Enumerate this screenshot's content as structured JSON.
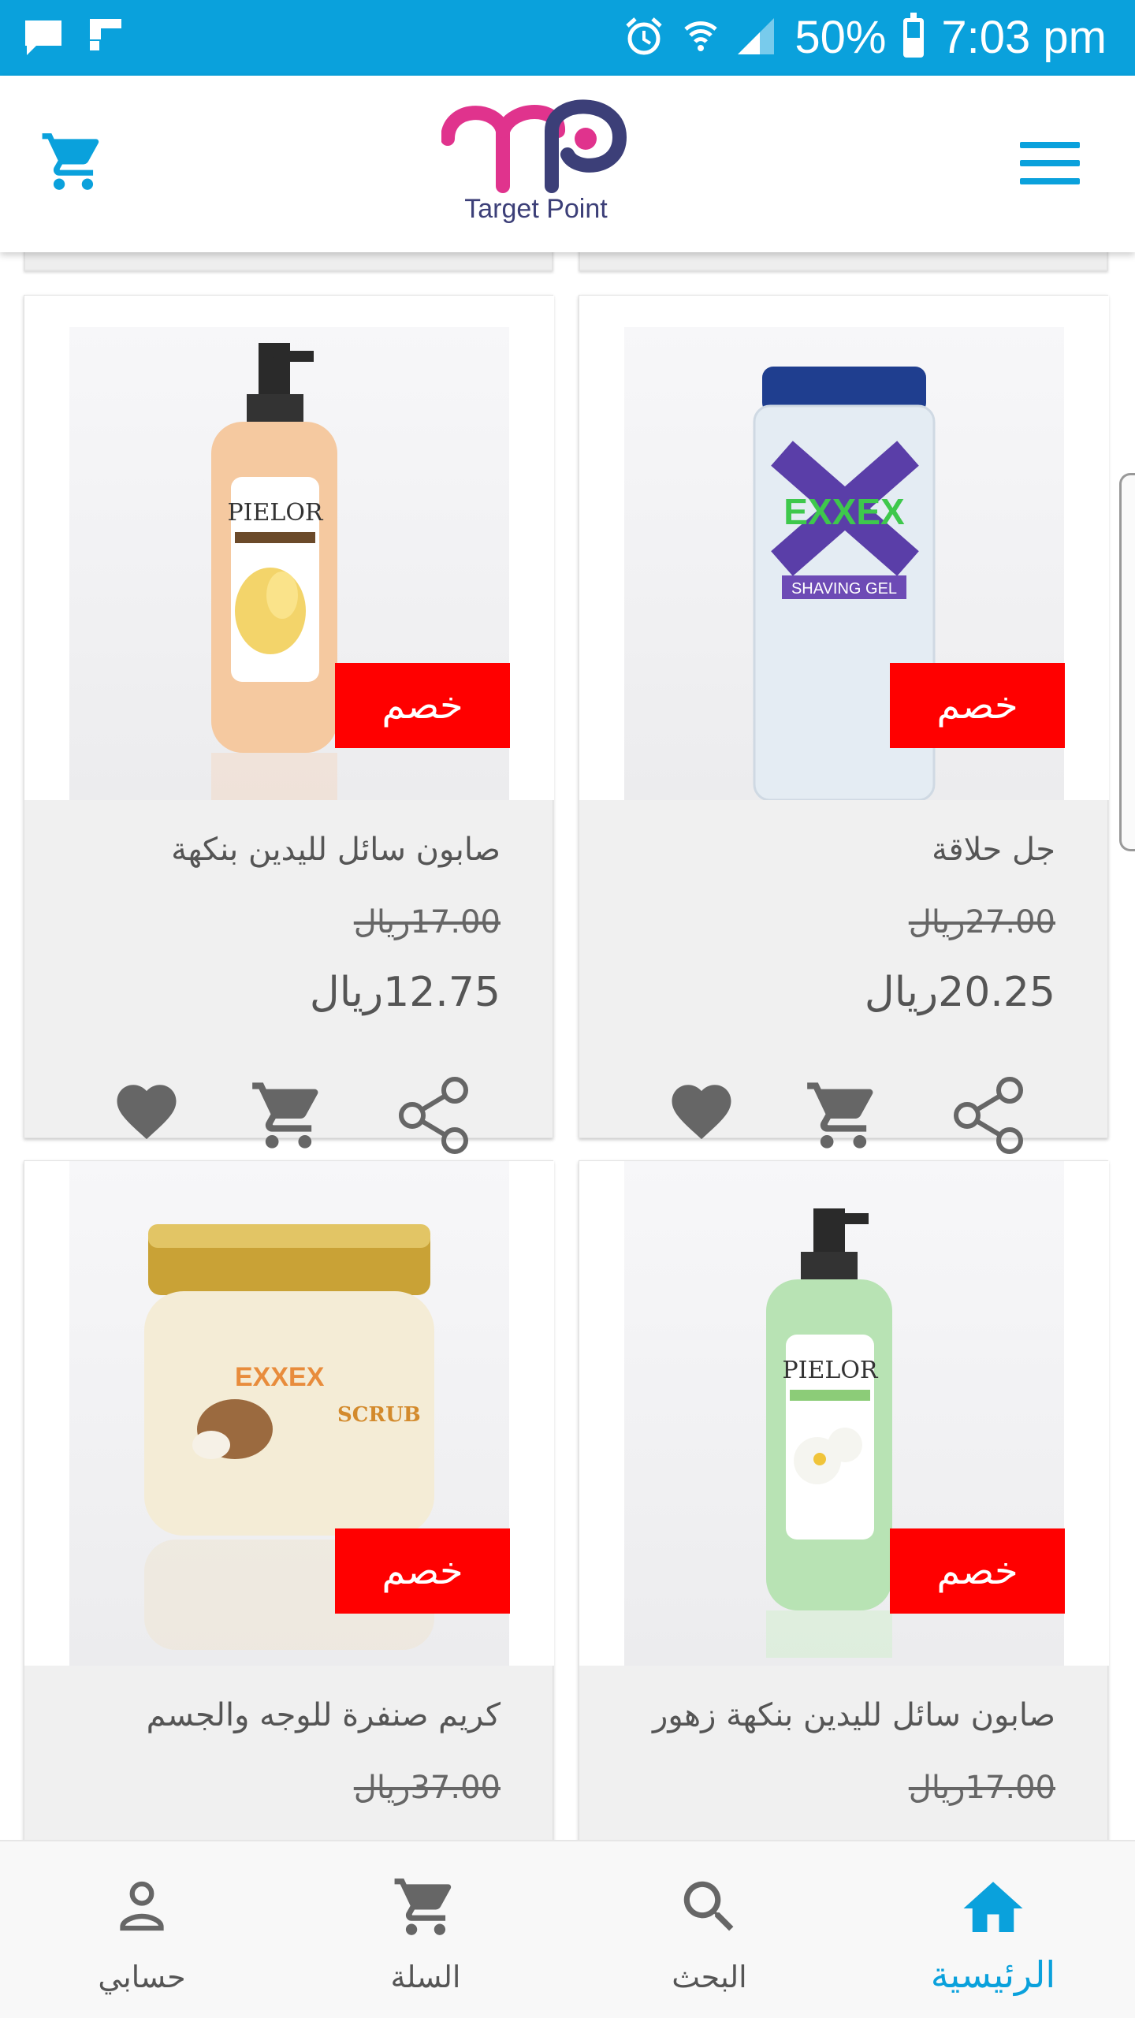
{
  "status_bar": {
    "battery": "50%",
    "battery_level": 0.5,
    "time": "7:03 pm"
  },
  "header": {
    "logo_text": "Target Point",
    "cart_icon": "cart-icon",
    "menu_icon": "hamburger-menu-icon"
  },
  "colors": {
    "accent": "#0aa1dc",
    "badge": "#ff0000",
    "logo_magenta": "#e0338d",
    "logo_navy": "#3c3f78"
  },
  "products": [
    {
      "name": "صابون سائل لليدين بنكهة",
      "badge": "خصم",
      "old_price": "17.00ريال",
      "new_price": "12.75ريال",
      "product": "PIELOR vanilla hand wash"
    },
    {
      "name": "جل حلاقة",
      "badge": "خصم",
      "old_price": "27.00ريال",
      "new_price": "20.25ريال",
      "product": "EXXEX shaving gel"
    },
    {
      "name": "كريم صنفرة للوجه والجسم",
      "badge": "خصم",
      "old_price": "37.00ريال",
      "new_price": "",
      "product": "EXXEX face & body scrub"
    },
    {
      "name": "صابون سائل لليدين بنكهة زهور",
      "badge": "خصم",
      "old_price": "17.00ريال",
      "new_price": "",
      "product": "PIELOR flower hand wash"
    }
  ],
  "card_actions": {
    "favorite_icon": "heart-icon",
    "cart_icon": "add-to-cart-icon",
    "share_icon": "share-icon"
  },
  "bottom_nav": [
    {
      "label": "حسابي",
      "icon": "person-icon"
    },
    {
      "label": "السلة",
      "icon": "cart-icon"
    },
    {
      "label": "البحث",
      "icon": "search-icon"
    },
    {
      "label": "الرئيسية",
      "icon": "home-icon",
      "active": true
    }
  ]
}
